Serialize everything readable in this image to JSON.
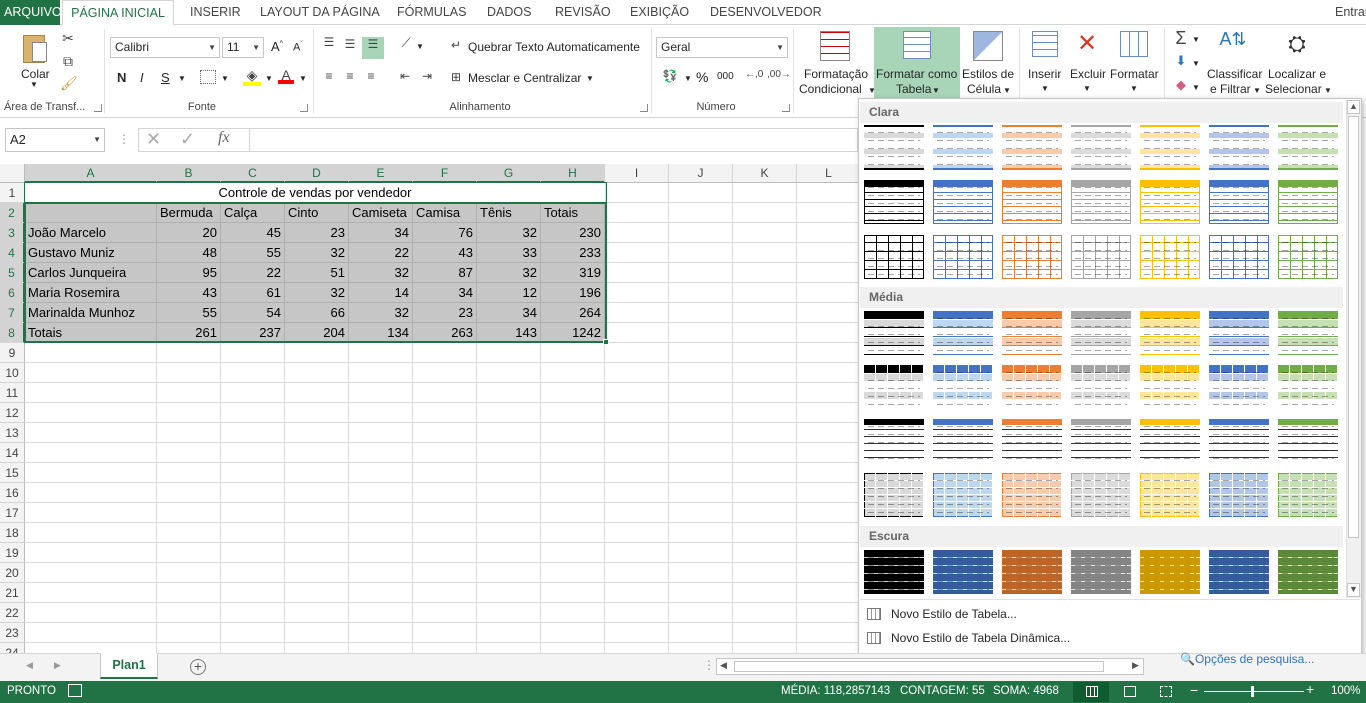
{
  "tabs": [
    {
      "id": "arquivo",
      "label": "ARQUIVO"
    },
    {
      "id": "pagina-inicial",
      "label": "PÁGINA INICIAL"
    },
    {
      "id": "inserir",
      "label": "INSERIR"
    },
    {
      "id": "layout",
      "label": "LAYOUT DA PÁGINA"
    },
    {
      "id": "formulas",
      "label": "FÓRMULAS"
    },
    {
      "id": "dados",
      "label": "DADOS"
    },
    {
      "id": "revisao",
      "label": "REVISÃO"
    },
    {
      "id": "exibicao",
      "label": "EXIBIÇÃO"
    },
    {
      "id": "desenvolvedor",
      "label": "DESENVOLVEDOR"
    }
  ],
  "signin": "Entrar",
  "ribbon": {
    "clipboard": {
      "paste": "Colar",
      "group": "Área de Transf..."
    },
    "font": {
      "name": "Calibri",
      "size": "11",
      "bold": "N",
      "italic": "I",
      "underline": "S",
      "group": "Fonte"
    },
    "alignment": {
      "wrap": "Quebrar Texto Automaticamente",
      "merge": "Mesclar e Centralizar",
      "group": "Alinhamento"
    },
    "number": {
      "format": "Geral",
      "percent": "%",
      "thousands": "000",
      "group": "Número"
    },
    "styles": {
      "conditional_1": "Formatação",
      "conditional_2": "Condicional",
      "format_table_1": "Formatar como",
      "format_table_2": "Tabela",
      "cell_styles_1": "Estilos de",
      "cell_styles_2": "Célula"
    },
    "cells": {
      "insert": "Inserir",
      "delete": "Excluir",
      "format": "Formatar"
    },
    "editing": {
      "sort_1": "Classificar",
      "sort_2": "e Filtrar",
      "find_1": "Localizar e",
      "find_2": "Selecionar"
    }
  },
  "formula_bar": {
    "name_box": "A2",
    "fx": "fx",
    "content": ""
  },
  "columns": [
    "A",
    "B",
    "C",
    "D",
    "E",
    "F",
    "G",
    "H",
    "I",
    "J",
    "K",
    "L"
  ],
  "rows": [
    "1",
    "2",
    "3",
    "4",
    "5",
    "6",
    "7",
    "8",
    "9",
    "10",
    "11",
    "12",
    "13",
    "14",
    "15",
    "16",
    "17",
    "18",
    "19",
    "20",
    "21",
    "22",
    "23",
    "24"
  ],
  "sheet": {
    "title": "Controle de vendas por vendedor",
    "headers": [
      "Bermuda",
      "Calça",
      "Cinto",
      "Camiseta",
      "Camisa",
      "Tênis",
      "Totais"
    ],
    "data": [
      {
        "name": "João Marcelo",
        "values": [
          "20",
          "45",
          "23",
          "34",
          "76",
          "32",
          "230"
        ]
      },
      {
        "name": "Gustavo Muniz",
        "values": [
          "48",
          "55",
          "32",
          "22",
          "43",
          "33",
          "233"
        ]
      },
      {
        "name": "Carlos Junqueira",
        "values": [
          "95",
          "22",
          "51",
          "32",
          "87",
          "32",
          "319"
        ]
      },
      {
        "name": "Maria Rosemira",
        "values": [
          "43",
          "61",
          "32",
          "14",
          "34",
          "12",
          "196"
        ]
      },
      {
        "name": "Marinalda Munhoz",
        "values": [
          "55",
          "54",
          "66",
          "32",
          "23",
          "34",
          "264"
        ]
      },
      {
        "name": "Totais",
        "values": [
          "261",
          "237",
          "204",
          "134",
          "263",
          "143",
          "1242"
        ]
      }
    ]
  },
  "gallery": {
    "sections": [
      "Clara",
      "Média",
      "Escura"
    ],
    "accent_colors": [
      "#000000",
      "#4472c4",
      "#ed7d31",
      "#a5a5a5",
      "#ffc000",
      "#4472c4",
      "#70ad47"
    ],
    "tint_colors": [
      "#d9d9d9",
      "#bdd7ee",
      "#f8cbad",
      "#dbdbdb",
      "#ffe699",
      "#b4c6e7",
      "#c6e0b4"
    ],
    "new_table_style": "Novo Estilo de Tabela...",
    "new_pivot_style": "Novo Estilo de Tabela Dinâmica...",
    "search_options": "Opções de pesquisa..."
  },
  "sheet_tabs": {
    "active": "Plan1"
  },
  "status": {
    "ready": "PRONTO",
    "average": "MÉDIA: 118,2857143",
    "count": "CONTAGEM: 55",
    "sum": "SOMA: 4968",
    "zoom": "100%"
  }
}
